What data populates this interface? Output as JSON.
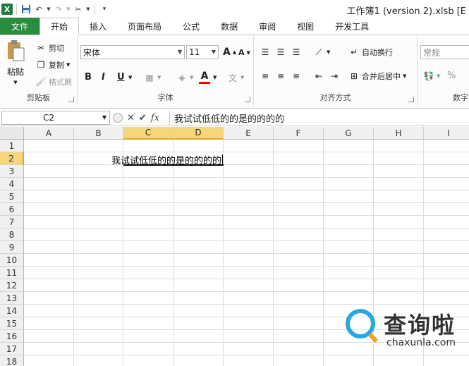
{
  "title_bar": {
    "doc_title": "工作簿1 (version 2).xlsb [E"
  },
  "tabs": [
    {
      "label": "文件",
      "key": "file"
    },
    {
      "label": "开始",
      "key": "home"
    },
    {
      "label": "插入",
      "key": "insert"
    },
    {
      "label": "页面布局",
      "key": "layout"
    },
    {
      "label": "公式",
      "key": "formulas"
    },
    {
      "label": "数据",
      "key": "data"
    },
    {
      "label": "审阅",
      "key": "review"
    },
    {
      "label": "视图",
      "key": "view"
    },
    {
      "label": "开发工具",
      "key": "developer"
    }
  ],
  "ribbon": {
    "clipboard": {
      "label": "剪贴板",
      "paste": "粘贴",
      "cut": "剪切",
      "copy": "复制",
      "format_painter": "格式刷"
    },
    "font": {
      "label": "字体",
      "font_name": "宋体",
      "font_size": "11",
      "bold": "B",
      "italic": "I",
      "underline": "U",
      "font_color": "#ff0000"
    },
    "alignment": {
      "label": "对齐方式",
      "wrap_text": "自动换行",
      "merge_center": "合并后居中"
    },
    "number": {
      "label": "数字",
      "format": "常规",
      "percent": "%"
    }
  },
  "formula_bar": {
    "name_box": "C2",
    "content": "我试试低低的的是的的的的"
  },
  "grid": {
    "columns": [
      "A",
      "B",
      "C",
      "D",
      "E",
      "F",
      "G",
      "H",
      "I"
    ],
    "selected_columns": [
      "C",
      "D"
    ],
    "rows": [
      "1",
      "2",
      "3",
      "4",
      "5",
      "6",
      "7",
      "8",
      "9",
      "10",
      "11",
      "12",
      "13",
      "14",
      "15",
      "16",
      "17",
      "18"
    ],
    "selected_row": "2",
    "active_cell_text": "我试试低低的的是的的的的"
  },
  "watermark": {
    "brand": "查询啦",
    "domain": "chaxunla.com"
  },
  "colors": {
    "file_tab": "#2a8c3f",
    "selection_header": "#f7d57a",
    "watermark_blue": "#2aa7e0"
  }
}
